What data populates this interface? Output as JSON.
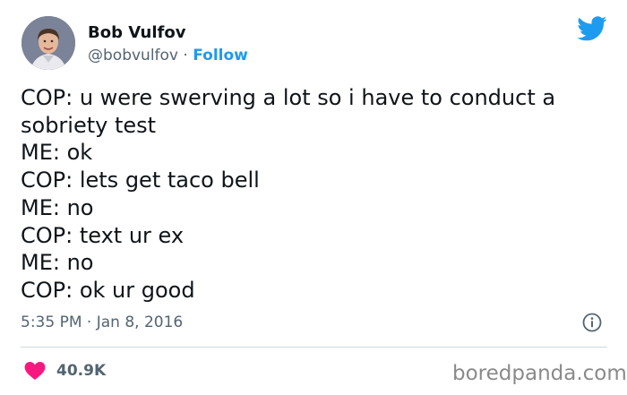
{
  "author": {
    "name": "Bob Vulfov",
    "handle": "@bobvulfov",
    "separator": "·",
    "follow_label": "Follow"
  },
  "tweet": {
    "lines": [
      "COP: u were swerving a lot so i have to conduct a",
      "sobriety test",
      "ME: ok",
      "COP: lets get taco bell",
      "ME: no",
      "COP: text ur ex",
      "ME: no",
      "COP: ok ur good"
    ],
    "timestamp": "5:35 PM · Jan 8, 2016",
    "likes": "40.9K"
  },
  "icons": {
    "avatar": "avatar",
    "brand": "twitter-bird-icon",
    "info": "info-icon",
    "like": "heart-icon"
  },
  "colors": {
    "accent": "#1d9bf0",
    "heart": "#f91880",
    "muted": "#536471",
    "text": "#0f1419"
  },
  "watermark": "boredpanda.com"
}
